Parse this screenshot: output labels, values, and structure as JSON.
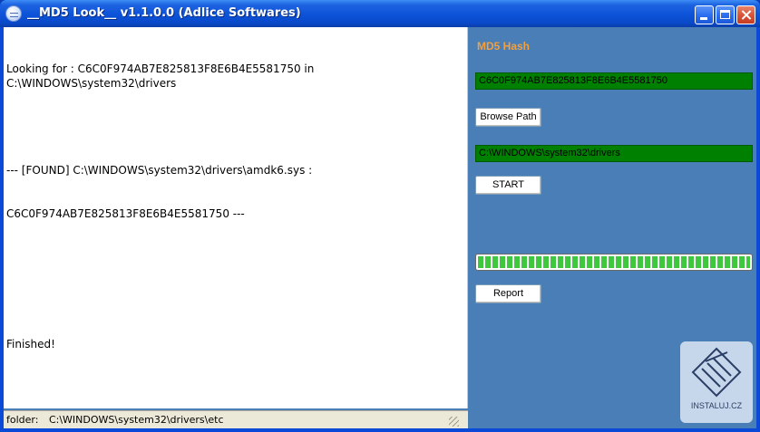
{
  "window": {
    "title": "__MD5 Look__ v1.1.0.0 (Adlice Softwares)"
  },
  "log": {
    "lines": [
      "Looking for : C6C0F974AB7E825813F8E6B4E5581750 in C:\\WINDOWS\\system32\\drivers",
      "",
      "--- [FOUND] C:\\WINDOWS\\system32\\drivers\\amdk6.sys :",
      "C6C0F974AB7E825813F8E6B4E5581750 ---",
      "",
      "",
      "Finished!"
    ]
  },
  "statusbar": {
    "label": "folder:",
    "value": "C:\\WINDOWS\\system32\\drivers\\etc"
  },
  "panel": {
    "md5_label": "MD5 Hash",
    "hash_value": "C6C0F974AB7E825813F8E6B4E5581750",
    "browse_label": "Browse Path",
    "path_value": "C:\\WINDOWS\\system32\\drivers",
    "start_label": "START",
    "progress": 1.0,
    "report_label": "Report"
  },
  "watermark": {
    "text": "INSTALUJ.CZ"
  },
  "colors": {
    "field_bg": "#008000",
    "accent_label": "#f0a040",
    "panel_bg": "#4a7eb7",
    "progress_green": "#3ec83e"
  }
}
